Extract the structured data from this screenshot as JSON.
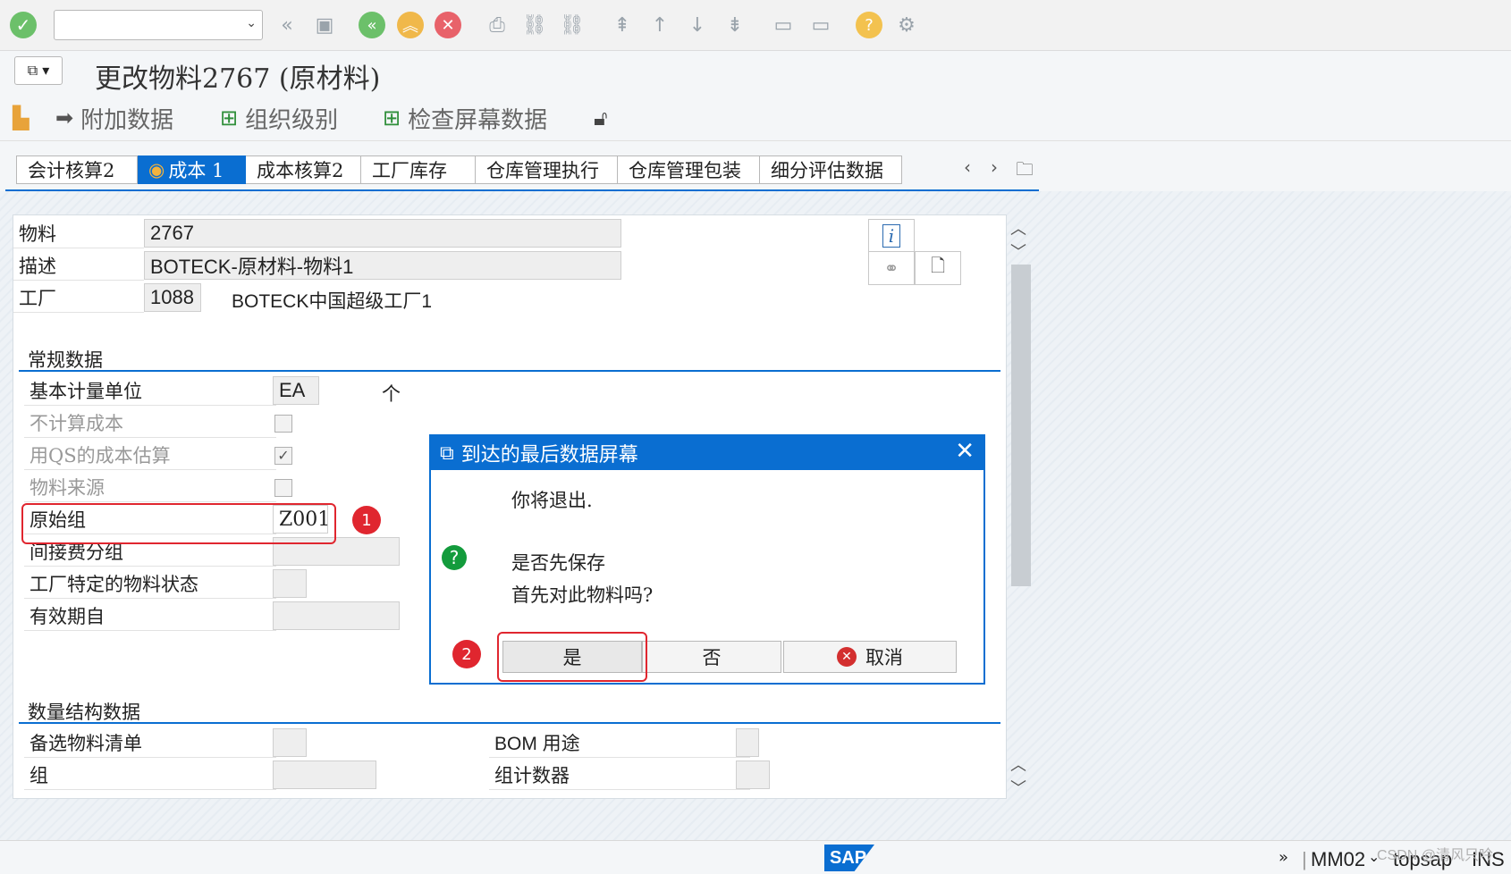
{
  "toolbar": {
    "command_field_value": "",
    "icons": [
      "enter-icon",
      "back-double-icon",
      "save-icon",
      "back-icon",
      "exit-icon",
      "cancel-icon",
      "print-icon",
      "find-icon",
      "find-next-icon",
      "first-page-icon",
      "previous-page-icon",
      "next-page-icon",
      "last-page-icon",
      "create-session-icon",
      "shortcut-icon",
      "help-icon",
      "settings-icon"
    ]
  },
  "title": "更改物料2767 (原材料)",
  "app_toolbar": {
    "additional_data": "附加数据",
    "org_levels": "组织级别",
    "check_screen_data": "检查屏幕数据"
  },
  "tabs": [
    {
      "label": "会计核算2",
      "active": false
    },
    {
      "label": "成本 1",
      "active": true
    },
    {
      "label": "成本核算2",
      "active": false
    },
    {
      "label": "工厂库存",
      "active": false
    },
    {
      "label": "仓库管理执行",
      "active": false
    },
    {
      "label": "仓库管理包装",
      "active": false
    },
    {
      "label": "细分评估数据",
      "active": false
    }
  ],
  "header": {
    "material_label": "物料",
    "material_value": "2767",
    "description_label": "描述",
    "description_value": "BOTECK-原材料-物料1",
    "plant_label": "工厂",
    "plant_value": "1088",
    "plant_name": "BOTECK中国超级工厂1"
  },
  "general": {
    "title": "常规数据",
    "base_uom_label": "基本计量单位",
    "base_uom_value": "EA",
    "base_uom_text": "个",
    "no_costing_label": "不计算成本",
    "qs_costing_label": "用QS的成本估算",
    "material_origin_label": "物料来源",
    "origin_group_label": "原始组",
    "origin_group_value": "Z001",
    "overhead_group_label": "间接费分组",
    "plant_status_label": "工厂特定的物料状态",
    "valid_from_label": "有效期自",
    "no_costing_checked": false,
    "qs_costing_checked": true,
    "material_origin_checked": false
  },
  "quantity": {
    "title": "数量结构数据",
    "alt_bom_label": "备选物料清单",
    "bom_usage_label": "BOM 用途",
    "group_label": "组",
    "group_counter_label": "组计数器"
  },
  "dialog": {
    "title": "到达的最后数据屏幕",
    "line1": "你将退出.",
    "line2": "是否先保存",
    "line3": "首先对此物料吗?",
    "yes": "是",
    "no": "否",
    "cancel": "取消"
  },
  "annotations": {
    "marker1": "1",
    "marker2": "2"
  },
  "status": {
    "tcode": "MM02",
    "system": "topsap",
    "mode": "INS",
    "logo": "SAP",
    "watermark": "CSDN @清风只吟"
  },
  "colors": {
    "accent": "#0a6ed1",
    "annotation": "#e0262f",
    "question": "#139b3c"
  }
}
